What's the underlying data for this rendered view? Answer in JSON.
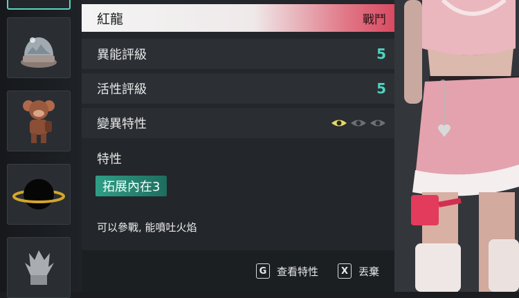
{
  "creature": {
    "name": "紅龍",
    "type_tag": "戰鬥"
  },
  "stats": [
    {
      "label": "異能評級",
      "value": "5"
    },
    {
      "label": "活性評級",
      "value": "5"
    }
  ],
  "mutation": {
    "label": "變異特性",
    "levels_active": 1,
    "levels_total": 3
  },
  "traits": {
    "title": "特性",
    "items": [
      "拓展內在3"
    ]
  },
  "description": "可以參戰, 能噴吐火焰",
  "footer": {
    "view_key": "G",
    "view_label": "查看特性",
    "discard_key": "X",
    "discard_label": "丟棄"
  },
  "colors": {
    "accent_teal": "#4fd3bf",
    "title_red": "#d94a62",
    "eye_active": "#e6d96a"
  },
  "inventory_icons": [
    "snow-globe-icon",
    "monkey-figurine-icon",
    "black-hole-orb-icon",
    "claw-statue-icon"
  ]
}
